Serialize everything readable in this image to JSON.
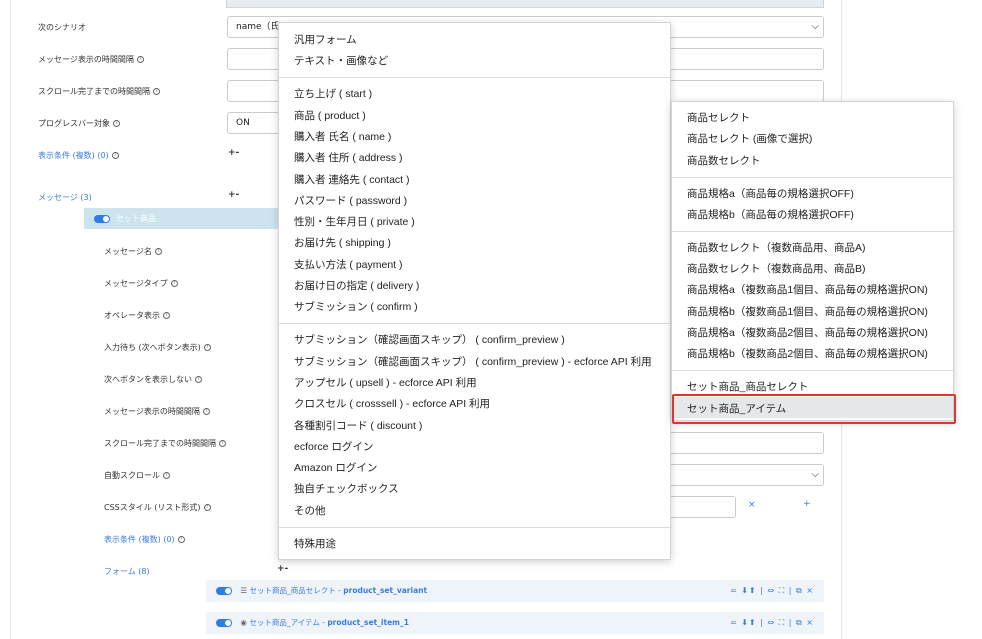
{
  "form": {
    "labels": {
      "next_scenario": "次のシナリオ",
      "msg_interval": "メッセージ表示の時間間隔",
      "scroll_interval": "スクロール完了までの時間間隔",
      "progress_target": "プログレスバー対象",
      "display_cond": "表示条件 (複数) (0)",
      "messages": "メッセージ (3)"
    },
    "next_scenario_value": "name（氏",
    "progress_value": "ON",
    "plus_minus": "+-"
  },
  "message": {
    "title": "セット商品",
    "labels": {
      "name": "メッセージ名",
      "type": "メッセージタイプ",
      "operator": "オペレータ表示",
      "input_wait": "入力待ち (次へボタン表示)",
      "hide_next": "次へボタンを表示しない",
      "interval": "メッセージ表示の時間間隔",
      "scroll": "スクロール完了までの時間間隔",
      "autoscroll": "自動スクロール",
      "css": "CSSスタイル (リスト形式)",
      "cond": "表示条件 (複数) (0)",
      "forms": "フォーム (8)"
    },
    "x": "×",
    "plus": "+",
    "plus_minus": "+-"
  },
  "rows": [
    {
      "icon": "☰",
      "label": "セット商品_商品セレクト - ",
      "key": "product_set_variant"
    },
    {
      "icon": "◉",
      "label": "セット商品_アイテム - ",
      "key": "product_set_item_1"
    }
  ],
  "row_tools": "= ⬇⬆ | ⇔ ⛶ | ⧉ ×",
  "menu_main": {
    "group1": [
      "汎用フォーム",
      "テキスト・画像など"
    ],
    "group2": [
      "立ち上げ ( start )",
      "商品 ( product )",
      "購入者 氏名 ( name )",
      "購入者 住所 ( address )",
      "購入者 連絡先 ( contact )",
      "パスワード ( password )",
      "性別・生年月日 ( private )",
      "お届け先 ( shipping )",
      "支払い方法 ( payment )",
      "お届け日の指定 ( delivery )",
      "サブミッション ( confirm )"
    ],
    "group3": [
      "サブミッション（確認画面スキップ） ( confirm_preview )",
      "サブミッション（確認画面スキップ） ( confirm_preview ) - ecforce API 利用",
      "アップセル ( upsell ) - ecforce API 利用",
      "クロスセル ( crosssell ) - ecforce API 利用",
      "各種割引コード ( discount )",
      "ecforce ログイン",
      "Amazon ログイン",
      "独自チェックボックス",
      "その他"
    ],
    "group4": [
      "特殊用途"
    ]
  },
  "menu_sub": {
    "group1": [
      "商品セレクト",
      "商品セレクト (画像で選択)",
      "商品数セレクト"
    ],
    "group2": [
      "商品規格a（商品毎の規格選択OFF)",
      "商品規格b（商品毎の規格選択OFF)"
    ],
    "group3": [
      "商品数セレクト（複数商品用、商品A)",
      "商品数セレクト（複数商品用、商品B)",
      "商品規格a（複数商品1個目、商品毎の規格選択ON)",
      "商品規格b（複数商品1個目、商品毎の規格選択ON)",
      "商品規格a（複数商品2個目、商品毎の規格選択ON)",
      "商品規格b（複数商品2個目、商品毎の規格選択ON)"
    ],
    "group4": [
      "セット商品_商品セレクト",
      "セット商品_アイテム"
    ],
    "selected": "セット商品_アイテム"
  },
  "colors": {
    "accent": "#3d7bd9",
    "highlight_border": "#e0352b",
    "selected_bg": "#e6e7ea"
  }
}
